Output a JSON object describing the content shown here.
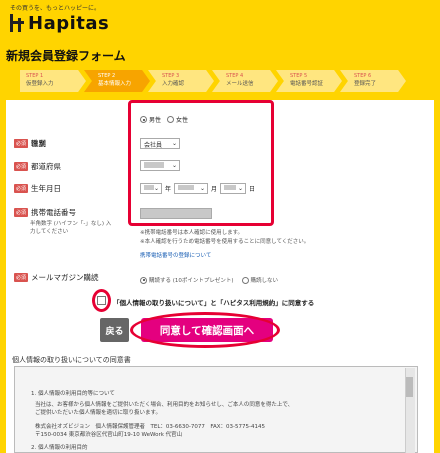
{
  "header": {
    "tagline": "その買うを、もっとハッピーに。",
    "logo_text": "Hapitas"
  },
  "page_title": "新規会員登録フォーム",
  "steps": [
    {
      "num": "STEP 1",
      "label": "仮登録入力"
    },
    {
      "num": "STEP 2",
      "label": "基本情報入力"
    },
    {
      "num": "STEP 3",
      "label": "入力確認"
    },
    {
      "num": "STEP 4",
      "label": "メール送信"
    },
    {
      "num": "STEP 5",
      "label": "電話番号認証"
    },
    {
      "num": "STEP 6",
      "label": "登録完了"
    }
  ],
  "form": {
    "required_badge": "必須",
    "gender": {
      "label": "性別",
      "male": "男性",
      "female": "女性"
    },
    "job": {
      "label": "職業",
      "value": "会社員"
    },
    "prefecture": {
      "label": "都道府県"
    },
    "birthday": {
      "label": "生年月日",
      "year_unit": "年",
      "month_unit": "月",
      "day_unit": "日"
    },
    "phone": {
      "label": "携帯電話番号",
      "hint": "半角数字 (ハイフン「-」なし) 入力してください",
      "note1": "※携帯電話番号は本人確認に使用します。",
      "note2": "※本人確認を行うため電話番号を使用することに同意してください。",
      "link": "携帯電話番号の登録について"
    },
    "mailmag": {
      "label": "メールマガジン購読",
      "opt_yes": "購読する (10ポイントプレゼント)",
      "opt_no": "購読しない"
    },
    "agree_text": "「個人情報の取り扱いについて」と「ハピタス利用規約」に同意する"
  },
  "buttons": {
    "back": "戻る",
    "agree": "同意して確認画面へ"
  },
  "privacy": {
    "title": "個人情報の取り扱いについての同意書",
    "lines": [
      "1. 個人情報の利用目的等について",
      "当社は、お客様から個人情報をご提供いただく場合、利用目的をお知らせし、ご本人の同意を得た上で、",
      "ご提供いただいた個人情報を適切に取り扱います。",
      "株式会社オズビジョン　個人情報保護管理者　TEL：03-6630-7077　FAX：03-5775-4145",
      "〒150-0034 東京都渋谷区代官山町19-10 WeWork 代官山",
      "2. 個人情報の利用目的"
    ]
  }
}
